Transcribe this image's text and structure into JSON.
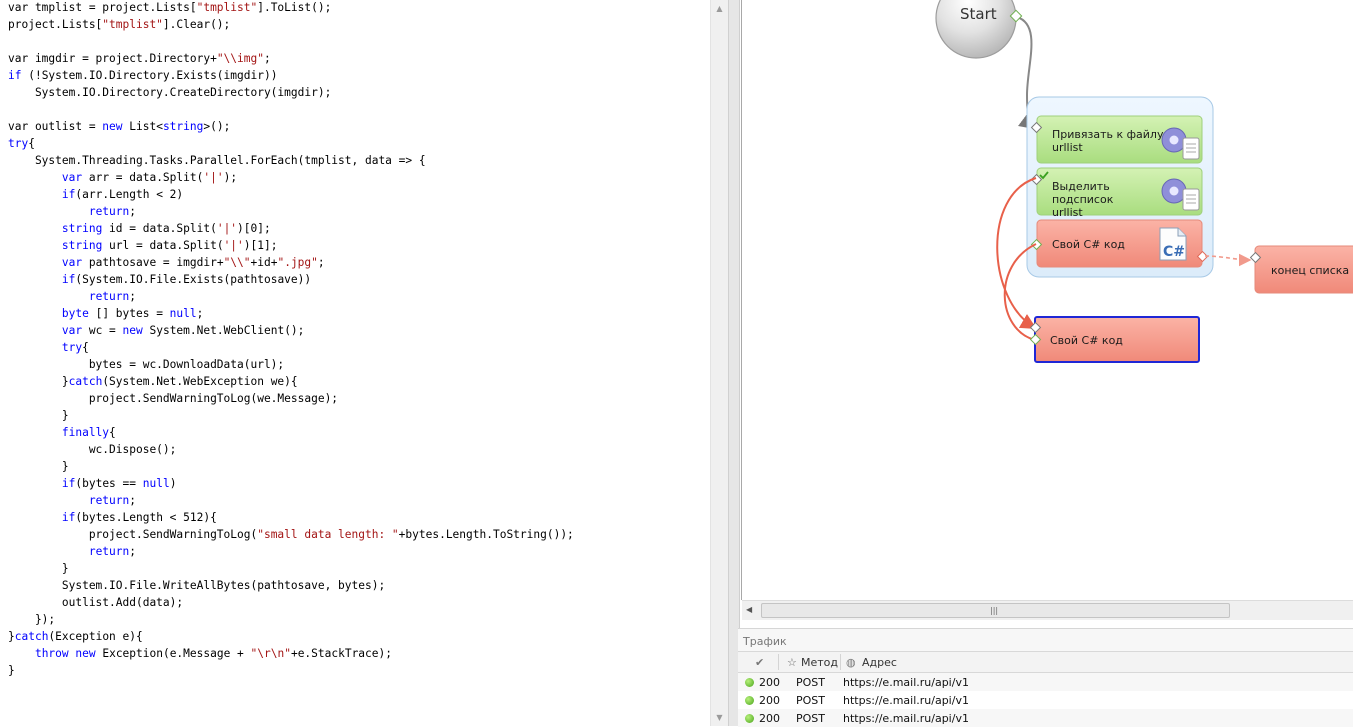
{
  "editor": {
    "lines": [
      [
        [
          "nm",
          "var tmplist = project.Lists["
        ],
        [
          "st",
          "\"tmplist\""
        ],
        [
          "nm",
          "].ToList();"
        ]
      ],
      [
        [
          "nm",
          "project.Lists["
        ],
        [
          "st",
          "\"tmplist\""
        ],
        [
          "nm",
          "].Clear();"
        ]
      ],
      [],
      [
        [
          "nm",
          "var imgdir = project.Directory+"
        ],
        [
          "st",
          "\"\\\\img\""
        ],
        [
          "nm",
          ";"
        ]
      ],
      [
        [
          "kw",
          "if"
        ],
        [
          "nm",
          " (!System.IO.Directory.Exists(imgdir))"
        ]
      ],
      [
        [
          "nm",
          "    System.IO.Directory.CreateDirectory(imgdir);"
        ]
      ],
      [],
      [
        [
          "nm",
          "var outlist = "
        ],
        [
          "kw",
          "new"
        ],
        [
          "nm",
          " List<"
        ],
        [
          "kw",
          "string"
        ],
        [
          "nm",
          ">();"
        ]
      ],
      [
        [
          "kw",
          "try"
        ],
        [
          "nm",
          "{"
        ]
      ],
      [
        [
          "nm",
          "    System.Threading.Tasks.Parallel.ForEach(tmplist, data => {"
        ]
      ],
      [
        [
          "nm",
          "        "
        ],
        [
          "kw",
          "var"
        ],
        [
          "nm",
          " arr = data.Split("
        ],
        [
          "st",
          "'|'"
        ],
        [
          "nm",
          ");"
        ]
      ],
      [
        [
          "nm",
          "        "
        ],
        [
          "kw",
          "if"
        ],
        [
          "nm",
          "(arr.Length < 2)"
        ]
      ],
      [
        [
          "nm",
          "            "
        ],
        [
          "kw",
          "return"
        ],
        [
          "nm",
          ";"
        ]
      ],
      [
        [
          "nm",
          "        "
        ],
        [
          "kw",
          "string"
        ],
        [
          "nm",
          " id = data.Split("
        ],
        [
          "st",
          "'|'"
        ],
        [
          "nm",
          ")[0];"
        ]
      ],
      [
        [
          "nm",
          "        "
        ],
        [
          "kw",
          "string"
        ],
        [
          "nm",
          " url = data.Split("
        ],
        [
          "st",
          "'|'"
        ],
        [
          "nm",
          ")[1];"
        ]
      ],
      [
        [
          "nm",
          "        "
        ],
        [
          "kw",
          "var"
        ],
        [
          "nm",
          " pathtosave = imgdir+"
        ],
        [
          "st",
          "\"\\\\\""
        ],
        [
          "nm",
          "+id+"
        ],
        [
          "st",
          "\".jpg\""
        ],
        [
          "nm",
          ";"
        ]
      ],
      [
        [
          "nm",
          "        "
        ],
        [
          "kw",
          "if"
        ],
        [
          "nm",
          "(System.IO.File.Exists(pathtosave))"
        ]
      ],
      [
        [
          "nm",
          "            "
        ],
        [
          "kw",
          "return"
        ],
        [
          "nm",
          ";"
        ]
      ],
      [
        [
          "nm",
          "        "
        ],
        [
          "kw",
          "byte"
        ],
        [
          "nm",
          " [] bytes = "
        ],
        [
          "kw",
          "null"
        ],
        [
          "nm",
          ";"
        ]
      ],
      [
        [
          "nm",
          "        "
        ],
        [
          "kw",
          "var"
        ],
        [
          "nm",
          " wc = "
        ],
        [
          "kw",
          "new"
        ],
        [
          "nm",
          " System.Net.WebClient();"
        ]
      ],
      [
        [
          "nm",
          "        "
        ],
        [
          "kw",
          "try"
        ],
        [
          "nm",
          "{"
        ]
      ],
      [
        [
          "nm",
          "            bytes = wc.DownloadData(url);"
        ]
      ],
      [
        [
          "nm",
          "        }"
        ],
        [
          "kw",
          "catch"
        ],
        [
          "nm",
          "(System.Net.WebException we){"
        ]
      ],
      [
        [
          "nm",
          "            project.SendWarningToLog(we.Message);"
        ]
      ],
      [
        [
          "nm",
          "        }"
        ]
      ],
      [
        [
          "nm",
          "        "
        ],
        [
          "kw",
          "finally"
        ],
        [
          "nm",
          "{"
        ]
      ],
      [
        [
          "nm",
          "            wc.Dispose();"
        ]
      ],
      [
        [
          "nm",
          "        }"
        ]
      ],
      [
        [
          "nm",
          "        "
        ],
        [
          "kw",
          "if"
        ],
        [
          "nm",
          "(bytes == "
        ],
        [
          "kw",
          "null"
        ],
        [
          "nm",
          ")"
        ]
      ],
      [
        [
          "nm",
          "            "
        ],
        [
          "kw",
          "return"
        ],
        [
          "nm",
          ";"
        ]
      ],
      [
        [
          "nm",
          "        "
        ],
        [
          "kw",
          "if"
        ],
        [
          "nm",
          "(bytes.Length < 512){"
        ]
      ],
      [
        [
          "nm",
          "            project.SendWarningToLog("
        ],
        [
          "st",
          "\"small data length: \""
        ],
        [
          "nm",
          "+bytes.Length.ToString());"
        ]
      ],
      [
        [
          "nm",
          "            "
        ],
        [
          "kw",
          "return"
        ],
        [
          "nm",
          ";"
        ]
      ],
      [
        [
          "nm",
          "        }"
        ]
      ],
      [
        [
          "nm",
          "        System.IO.File.WriteAllBytes(pathtosave, bytes);"
        ]
      ],
      [
        [
          "nm",
          "        outlist.Add(data);"
        ]
      ],
      [
        [
          "nm",
          "    });"
        ]
      ],
      [
        [
          "nm",
          "}"
        ],
        [
          "kw",
          "catch"
        ],
        [
          "nm",
          "(Exception e){"
        ]
      ],
      [
        [
          "nm",
          "    "
        ],
        [
          "kw",
          "throw"
        ],
        [
          "nm",
          " "
        ],
        [
          "kw",
          "new"
        ],
        [
          "nm",
          " Exception(e.Message + "
        ],
        [
          "st",
          "\"\\r\\n\""
        ],
        [
          "nm",
          "+e.StackTrace);"
        ]
      ],
      [
        [
          "nm",
          "}"
        ]
      ]
    ]
  },
  "canvas": {
    "start_label": "Start",
    "block_bind_label": "Привязать к файлу urllist",
    "block_select_label": "Выделить подсписок urllist",
    "block_csharp_label": "Свой C# код",
    "block_end_label": "конец списка",
    "block_csharp2_label": "Свой C# код"
  },
  "traffic": {
    "title": "Трафик",
    "columns": {
      "method": "Метод",
      "address": "Адрес"
    },
    "rows": [
      {
        "status": "200",
        "method": "POST",
        "url": "https://e.mail.ru/api/v1"
      },
      {
        "status": "200",
        "method": "POST",
        "url": "https://e.mail.ru/api/v1"
      },
      {
        "status": "200",
        "method": "POST",
        "url": "https://e.mail.ru/api/v1"
      }
    ]
  }
}
